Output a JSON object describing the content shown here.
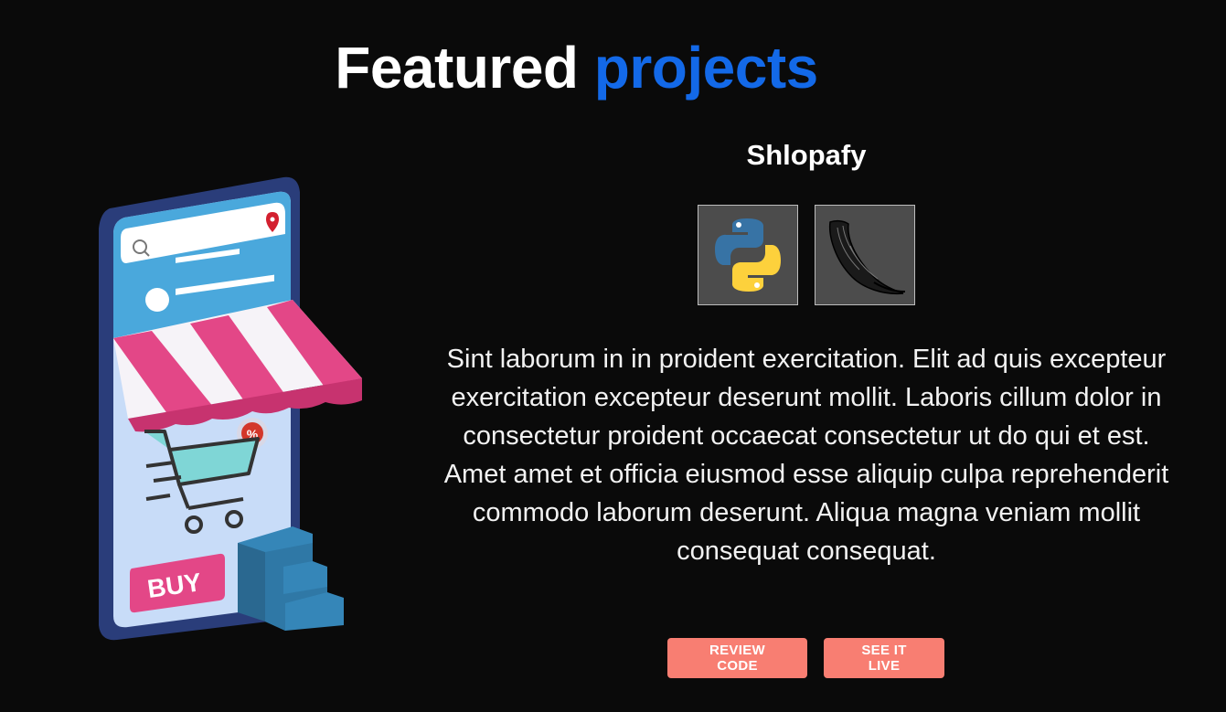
{
  "section": {
    "title_part1": "Featured",
    "title_part2": "projects"
  },
  "project": {
    "name": "Shlopafy",
    "technologies": [
      {
        "name": "python-icon"
      },
      {
        "name": "flask-icon"
      }
    ],
    "description": "Sint laborum in in proident exercitation. Elit ad quis excepteur exercitation excepteur deserunt mollit. Laboris cillum dolor in consectetur proident occaecat consectetur ut do qui et est. Amet amet et officia eiusmod esse aliquip culpa reprehenderit commodo laborum deserunt. Aliqua magna veniam mollit consequat consequat.",
    "buttons": {
      "review_code": "REVIEW CODE",
      "see_live": "SEE IT LIVE"
    },
    "illustration": {
      "buy_label": "BUY",
      "percent_label": "%"
    }
  },
  "colors": {
    "background": "#0a0a0a",
    "accent_blue": "#1369e8",
    "button": "#f87e72"
  }
}
